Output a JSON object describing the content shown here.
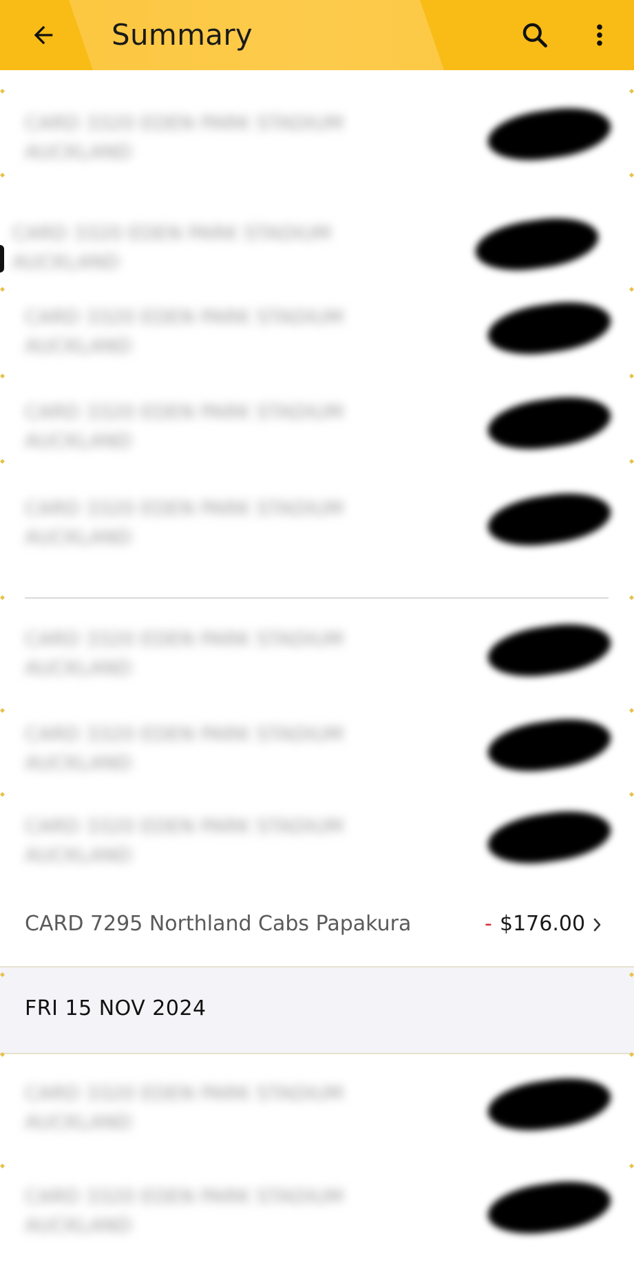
{
  "header": {
    "title": "Summary",
    "back_icon": "arrow-left-icon",
    "search_icon": "search-icon",
    "more_icon": "more-vertical-icon",
    "bg_color": "#F9BC16"
  },
  "redacted_transactions": [
    {
      "description": "CARD 3320 EDEN PARK STADIUM AUCKLAND"
    },
    {
      "description": "CARD 3320 EDEN PARK STADIUM AUCKLAND"
    },
    {
      "description": "CARD 3320 EDEN PARK STADIUM AUCKLAND"
    },
    {
      "description": "CARD 3320 EDEN PARK STADIUM AUCKLAND"
    },
    {
      "description": "CARD 3320 EDEN PARK STADIUM AUCKLAND"
    },
    {
      "description": "CARD 3320 EDEN PARK STADIUM AUCKLAND"
    },
    {
      "description": "CARD 3320 EDEN PARK STADIUM AUCKLAND"
    },
    {
      "description": "CARD 3320 EDEN PARK STADIUM AUCKLAND"
    },
    {
      "description": "CARD 3320 EDEN PARK STADIUM AUCKLAND"
    },
    {
      "description": "CARD 3320 EDEN PARK STADIUM AUCKLAND"
    }
  ],
  "visible_transaction": {
    "description": "CARD 7295 Northland Cabs Papakura",
    "sign": "-",
    "amount": "$176.00",
    "icon": "chevron-right-icon"
  },
  "date_header": {
    "label": "FRI 15 NOV 2024"
  }
}
